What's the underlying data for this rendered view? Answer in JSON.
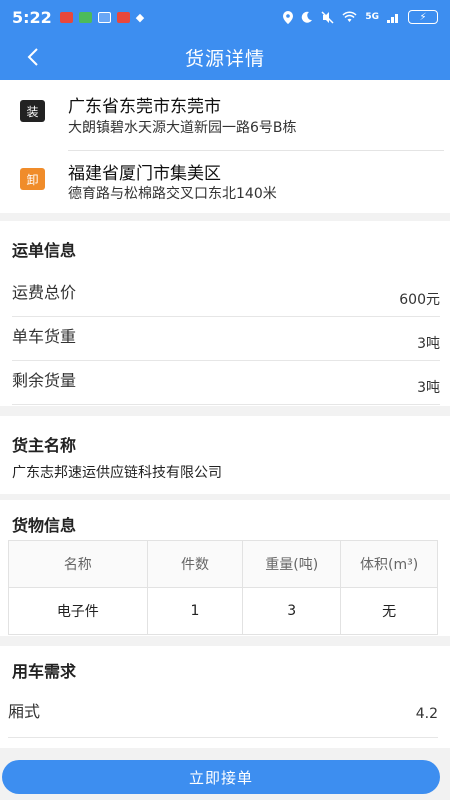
{
  "status_bar": {
    "time": "5:22",
    "network": "5G",
    "battery": "⚡"
  },
  "header": {
    "title": "货源详情"
  },
  "route": {
    "load": {
      "tag": "装",
      "region": "广东省东莞市东莞市",
      "address": "大朗镇碧水天源大道新园一路6号B栋"
    },
    "unload": {
      "tag": "卸",
      "region": "福建省厦门市集美区",
      "address": "德育路与松棉路交叉口东北140米"
    }
  },
  "waybill": {
    "title": "运单信息",
    "rows": [
      {
        "label": "运费总价",
        "value": "600元"
      },
      {
        "label": "单车货重",
        "value": "3吨"
      },
      {
        "label": "剩余货量",
        "value": "3吨"
      }
    ]
  },
  "shipper": {
    "title": "货主名称",
    "name": "广东志邦速运供应链科技有限公司"
  },
  "goods": {
    "title": "货物信息",
    "headers": [
      "名称",
      "件数",
      "重量(吨)",
      "体积(m³)"
    ],
    "rows": [
      [
        "电子件",
        "1",
        "3",
        "无"
      ]
    ]
  },
  "vehicle": {
    "title": "用车需求",
    "type_label": "厢式",
    "length_value": "4.2"
  },
  "actions": {
    "accept_label": "立即接单"
  },
  "colors": {
    "primary": "#3d8ef0",
    "load_tag": "#222222",
    "unload_tag": "#f08c2a"
  }
}
